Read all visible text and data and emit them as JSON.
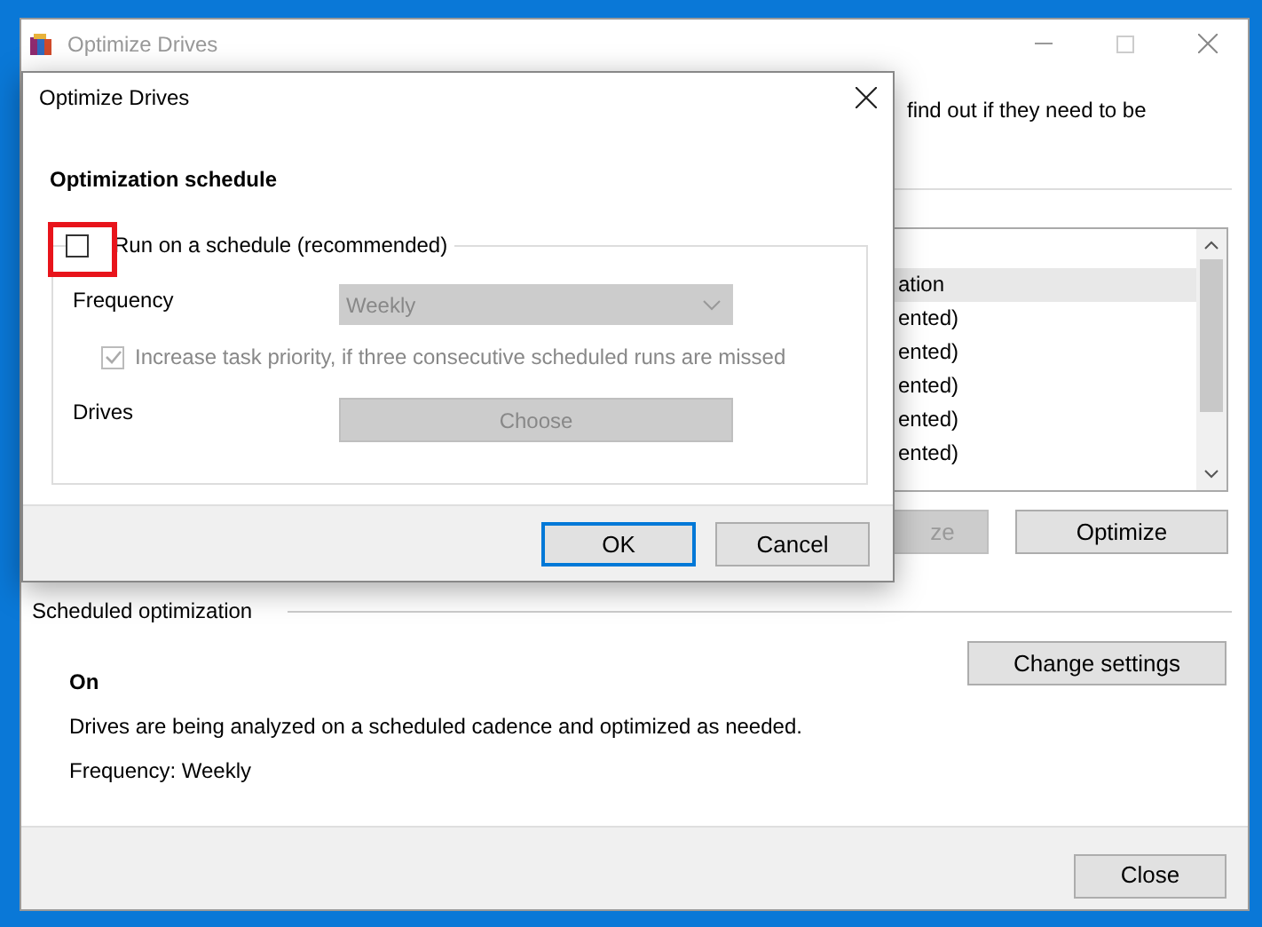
{
  "main_window": {
    "title": "Optimize Drives",
    "intro_text": "find out if they need to be",
    "drive_list": {
      "rows": [
        {
          "text": "ation",
          "selected": true
        },
        {
          "text": "ented)",
          "selected": false
        },
        {
          "text": "ented)",
          "selected": false
        },
        {
          "text": "ented)",
          "selected": false
        },
        {
          "text": "ented)",
          "selected": false
        },
        {
          "text": "ented)",
          "selected": false
        }
      ]
    },
    "buttons": [
      {
        "label": "ze",
        "disabled": true
      },
      {
        "label": "Optimize",
        "disabled": false
      }
    ],
    "scheduled_optimization": {
      "heading": "Scheduled optimization",
      "status": "On",
      "description": "Drives are being analyzed on a scheduled cadence and optimized as needed.",
      "frequency": "Frequency: Weekly",
      "button": "Change settings"
    },
    "close_button": "Close"
  },
  "dialog": {
    "title": "Optimize Drives",
    "heading": "Optimization schedule",
    "run_on_schedule": {
      "label": "Run on a schedule (recommended)",
      "checked": false,
      "highlighted": true
    },
    "frequency": {
      "label": "Frequency",
      "value": "Weekly",
      "disabled": true
    },
    "increase_priority": {
      "label": "Increase task priority, if three consecutive scheduled runs are missed",
      "checked": true,
      "disabled": true
    },
    "drives": {
      "label": "Drives",
      "button": "Choose",
      "disabled": true
    },
    "buttons": [
      {
        "label": "OK",
        "default": true
      },
      {
        "label": "Cancel",
        "default": false
      }
    ]
  }
}
